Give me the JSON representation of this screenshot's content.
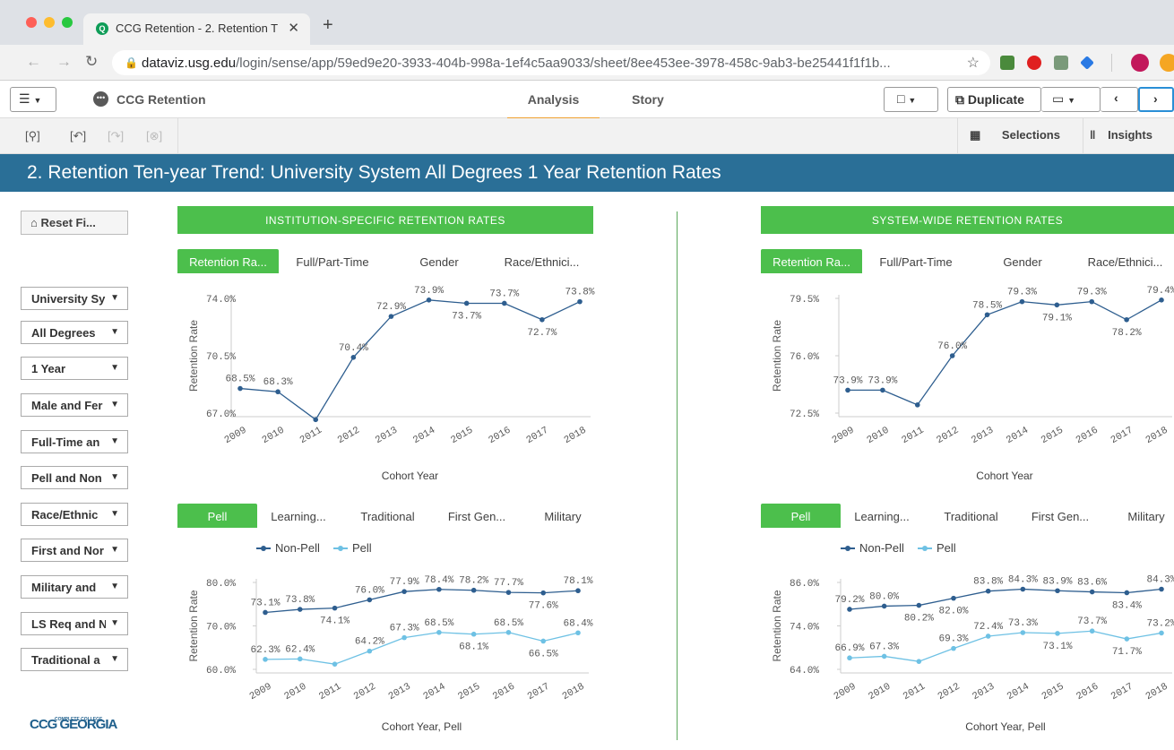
{
  "browser": {
    "tab_title": "CCG Retention - 2. Retention T",
    "tab_close": "✕",
    "new_tab": "+",
    "url_host": "dataviz.usg.edu",
    "url_path": "/login/sense/app/59ed9e20-3933-404b-998a-1ef4c5aa9033/sheet/8ee453ee-3978-458c-9ab3-be25441f1f1b..."
  },
  "qlik": {
    "app_name": "CCG Retention",
    "nav_tabs": [
      "Analysis",
      "Story"
    ],
    "duplicate_label": "Duplicate",
    "selections_label": "Selections",
    "insights_label": "Insights"
  },
  "sheet_title": "2. Retention Ten-year Trend: University System All Degrees 1 Year Retention Rates",
  "sidebar": {
    "reset_label": "Reset Fi...",
    "filters": [
      "University Sy",
      "All Degrees",
      "1 Year",
      "Male and Fer",
      "Full-Time an",
      "Pell and Non",
      "Race/Ethnic",
      "First and Nor",
      "Military and",
      "LS Req and N",
      "Traditional a"
    ],
    "logo_small": "COMPLETE COLLEGE",
    "logo_text": "CCG GEORGIA"
  },
  "panels": {
    "left_banner": "INSTITUTION-SPECIFIC RETENTION RATES",
    "right_banner": "SYSTEM-WIDE RETENTION RATES",
    "top_tabs": [
      "Retention Ra...",
      "Full/Part-Time",
      "Gender",
      "Race/Ethnici..."
    ],
    "bottom_tabs": [
      "Pell",
      "Learning...",
      "Traditional",
      "First Gen...",
      "Military"
    ]
  },
  "colors": {
    "dark_series": "#2e5e8f",
    "light_series": "#6ec1e4",
    "header_blue": "#2a6f97",
    "green": "#4cbf4c"
  },
  "chart_data": [
    {
      "type": "line",
      "x": [
        "2009",
        "2010",
        "2011",
        "2012",
        "2013",
        "2014",
        "2015",
        "2016",
        "2017",
        "2018"
      ],
      "series": [
        {
          "values": [
            68.5,
            68.3,
            66.6,
            70.4,
            72.9,
            73.9,
            73.7,
            73.7,
            72.7,
            73.8
          ],
          "labels": [
            "68.5%",
            "68.3%",
            "",
            "70.4%",
            "72.9%",
            "73.9%",
            "73.7%",
            "73.7%",
            "72.7%",
            "73.8%"
          ]
        }
      ],
      "yticks": [
        "74.0%",
        "70.5%",
        "67.0%"
      ],
      "ylim": [
        67.0,
        74.0
      ],
      "xlabel": "Cohort Year",
      "ylabel": "Retention Rate"
    },
    {
      "type": "line",
      "x": [
        "2009",
        "2010",
        "2011",
        "2012",
        "2013",
        "2014",
        "2015",
        "2016",
        "2017",
        "2018"
      ],
      "series": [
        {
          "values": [
            73.9,
            73.9,
            73.0,
            76.0,
            78.5,
            79.3,
            79.1,
            79.3,
            78.2,
            79.4
          ],
          "labels": [
            "73.9%",
            "73.9%",
            "",
            "76.0%",
            "78.5%",
            "79.3%",
            "79.1%",
            "79.3%",
            "78.2%",
            "79.4%"
          ]
        }
      ],
      "yticks": [
        "79.5%",
        "76.0%",
        "72.5%"
      ],
      "ylim": [
        72.5,
        79.5
      ],
      "xlabel": "Cohort Year",
      "ylabel": "Retention Rate"
    },
    {
      "type": "line",
      "x": [
        "2009",
        "2010",
        "2011",
        "2012",
        "2013",
        "2014",
        "2015",
        "2016",
        "2017",
        "2018"
      ],
      "legend": [
        "Non-Pell",
        "Pell"
      ],
      "series": [
        {
          "name": "Non-Pell",
          "values": [
            73.1,
            73.8,
            74.1,
            76.0,
            77.9,
            78.4,
            78.2,
            77.7,
            77.6,
            78.1
          ],
          "labels": [
            "73.1%",
            "73.8%",
            "74.1%",
            "76.0%",
            "77.9%",
            "78.4%",
            "78.2%",
            "77.7%",
            "77.6%",
            "78.1%"
          ]
        },
        {
          "name": "Pell",
          "values": [
            62.3,
            62.4,
            61.2,
            64.2,
            67.3,
            68.5,
            68.1,
            68.5,
            66.5,
            68.4
          ],
          "labels": [
            "62.3%",
            "62.4%",
            "",
            "64.2%",
            "67.3%",
            "68.5%",
            "68.1%",
            "68.5%",
            "66.5%",
            "68.4%"
          ]
        }
      ],
      "yticks": [
        "80.0%",
        "70.0%",
        "60.0%"
      ],
      "ylim": [
        60.0,
        80.0
      ],
      "xlabel": "Cohort Year, Pell",
      "ylabel": "Retention Rate"
    },
    {
      "type": "line",
      "x": [
        "2009",
        "2010",
        "2011",
        "2012",
        "2013",
        "2014",
        "2015",
        "2016",
        "2017",
        "2018"
      ],
      "legend": [
        "Non-Pell",
        "Pell"
      ],
      "series": [
        {
          "name": "Non-Pell",
          "values": [
            79.2,
            80.0,
            80.2,
            82.0,
            83.8,
            84.3,
            83.9,
            83.6,
            83.4,
            84.3
          ],
          "labels": [
            "79.2%",
            "80.0%",
            "80.2%",
            "82.0%",
            "83.8%",
            "84.3%",
            "83.9%",
            "83.6%",
            "83.4%",
            "84.3%"
          ]
        },
        {
          "name": "Pell",
          "values": [
            66.9,
            67.3,
            66.0,
            69.3,
            72.4,
            73.3,
            73.1,
            73.7,
            71.7,
            73.2
          ],
          "labels": [
            "66.9%",
            "67.3%",
            "",
            "69.3%",
            "72.4%",
            "73.3%",
            "73.1%",
            "73.7%",
            "71.7%",
            "73.2%"
          ]
        }
      ],
      "yticks": [
        "86.0%",
        "74.0%",
        "64.0%"
      ],
      "ylim": [
        64.0,
        86.0
      ],
      "xlabel": "Cohort Year, Pell",
      "ylabel": "Retention Rate"
    }
  ]
}
